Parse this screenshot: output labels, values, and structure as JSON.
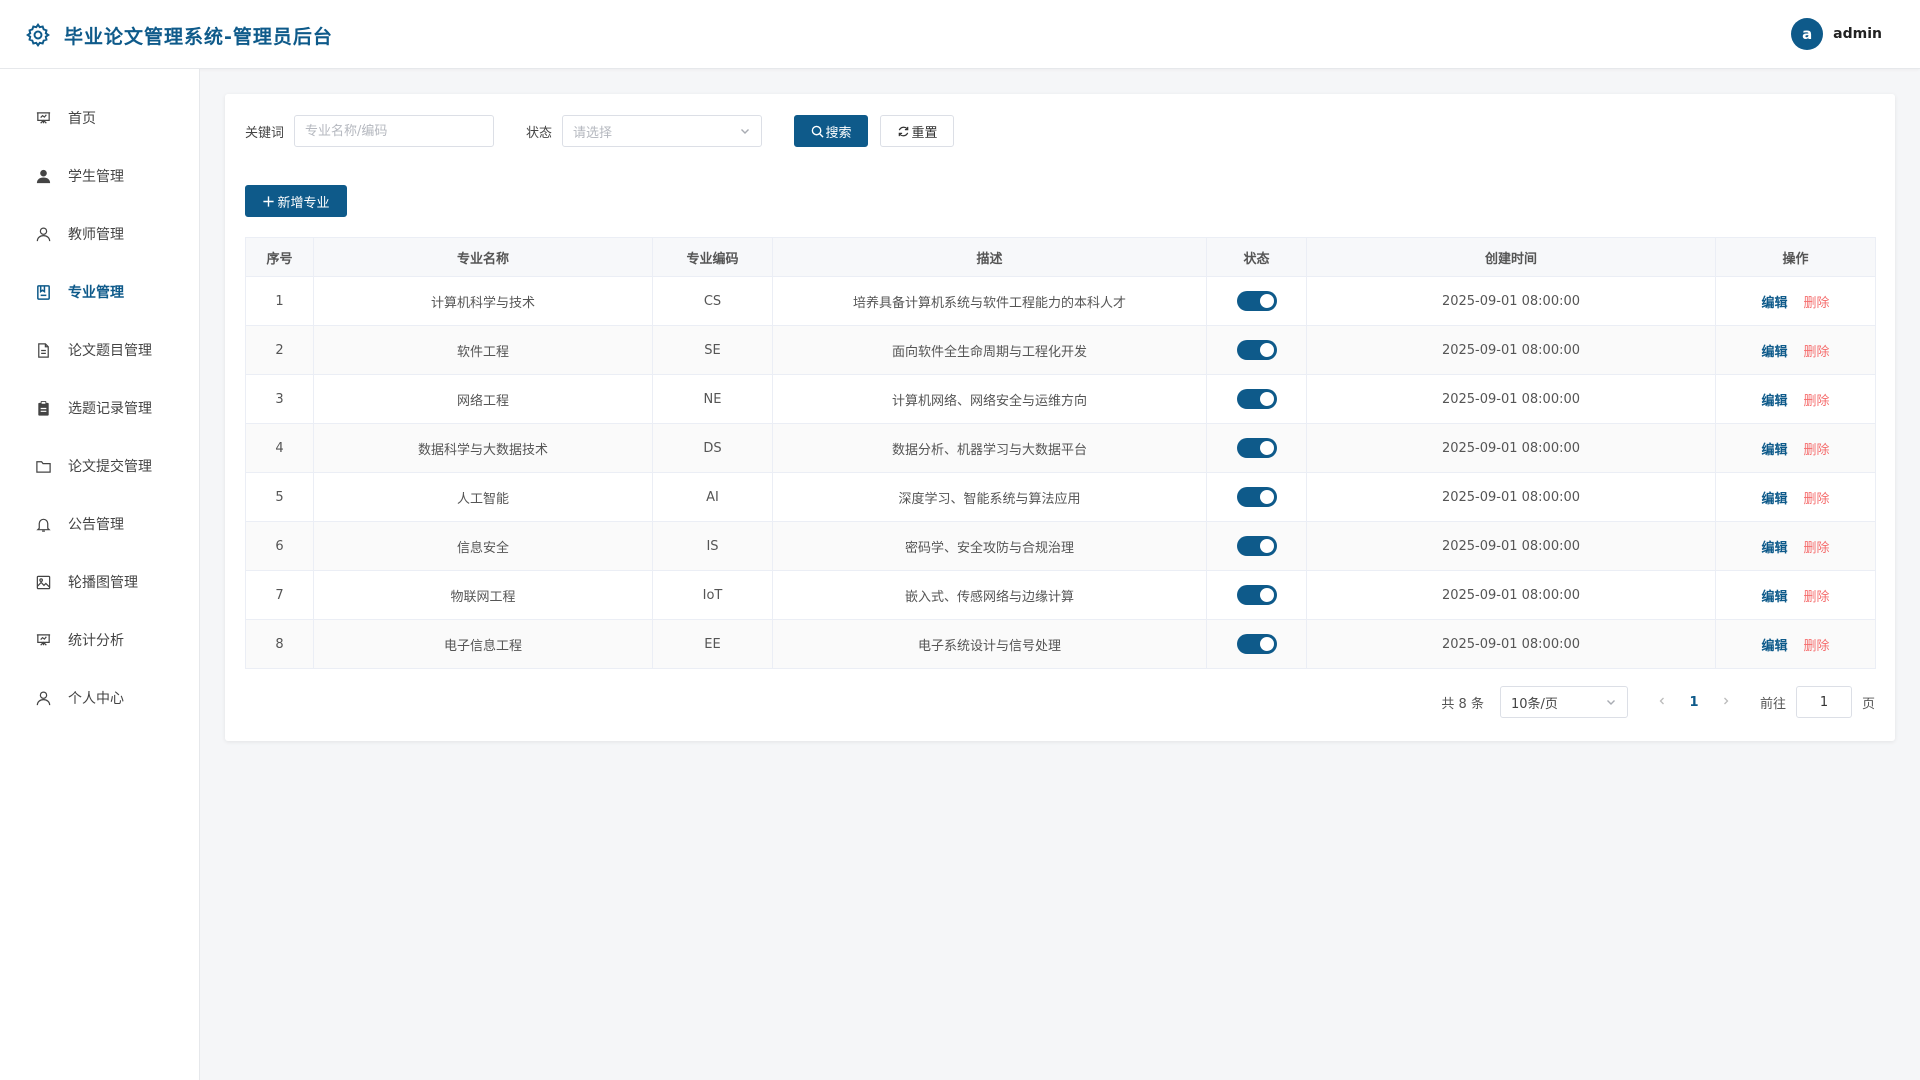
{
  "header": {
    "title": "毕业论文管理系统-管理员后台",
    "avatar_letter": "a",
    "username": "admin",
    "brand_color": "#0e5a8a"
  },
  "sidebar": {
    "items": [
      {
        "label": "首页",
        "icon": "presentation-icon",
        "active": false
      },
      {
        "label": "学生管理",
        "icon": "user-filled-icon",
        "active": false
      },
      {
        "label": "教师管理",
        "icon": "user-outline-icon",
        "active": false
      },
      {
        "label": "专业管理",
        "icon": "notebook-icon",
        "active": true
      },
      {
        "label": "论文题目管理",
        "icon": "document-icon",
        "active": false
      },
      {
        "label": "选题记录管理",
        "icon": "clipboard-icon",
        "active": false
      },
      {
        "label": "论文提交管理",
        "icon": "folder-icon",
        "active": false
      },
      {
        "label": "公告管理",
        "icon": "bell-icon",
        "active": false
      },
      {
        "label": "轮播图管理",
        "icon": "picture-icon",
        "active": false
      },
      {
        "label": "统计分析",
        "icon": "chart-board-icon",
        "active": false
      },
      {
        "label": "个人中心",
        "icon": "user-outline-icon",
        "active": false
      }
    ]
  },
  "filters": {
    "keyword_label": "关键词",
    "keyword_placeholder": "专业名称/编码",
    "keyword_value": "",
    "status_label": "状态",
    "status_placeholder": "请选择",
    "search_label": "搜索",
    "reset_label": "重置"
  },
  "toolbar": {
    "add_label": "新增专业"
  },
  "table": {
    "columns": [
      "序号",
      "专业名称",
      "专业编码",
      "描述",
      "状态",
      "创建时间",
      "操作"
    ],
    "rows": [
      {
        "no": "1",
        "name": "计算机科学与技术",
        "code": "CS",
        "desc": "培养具备计算机系统与软件工程能力的本科人才",
        "enabled": true,
        "created": "2025-09-01 08:00:00"
      },
      {
        "no": "2",
        "name": "软件工程",
        "code": "SE",
        "desc": "面向软件全生命周期与工程化开发",
        "enabled": true,
        "created": "2025-09-01 08:00:00"
      },
      {
        "no": "3",
        "name": "网络工程",
        "code": "NE",
        "desc": "计算机网络、网络安全与运维方向",
        "enabled": true,
        "created": "2025-09-01 08:00:00"
      },
      {
        "no": "4",
        "name": "数据科学与大数据技术",
        "code": "DS",
        "desc": "数据分析、机器学习与大数据平台",
        "enabled": true,
        "created": "2025-09-01 08:00:00"
      },
      {
        "no": "5",
        "name": "人工智能",
        "code": "AI",
        "desc": "深度学习、智能系统与算法应用",
        "enabled": true,
        "created": "2025-09-01 08:00:00"
      },
      {
        "no": "6",
        "name": "信息安全",
        "code": "IS",
        "desc": "密码学、安全攻防与合规治理",
        "enabled": true,
        "created": "2025-09-01 08:00:00"
      },
      {
        "no": "7",
        "name": "物联网工程",
        "code": "IoT",
        "desc": "嵌入式、传感网络与边缘计算",
        "enabled": true,
        "created": "2025-09-01 08:00:00"
      },
      {
        "no": "8",
        "name": "电子信息工程",
        "code": "EE",
        "desc": "电子系统设计与信号处理",
        "enabled": true,
        "created": "2025-09-01 08:00:00"
      }
    ],
    "edit_label": "编辑",
    "delete_label": "删除"
  },
  "pagination": {
    "total_text": "共 8 条",
    "page_size_text": "10条/页",
    "current_page": "1",
    "goto_label": "前往",
    "goto_value": "1",
    "goto_suffix": "页"
  }
}
